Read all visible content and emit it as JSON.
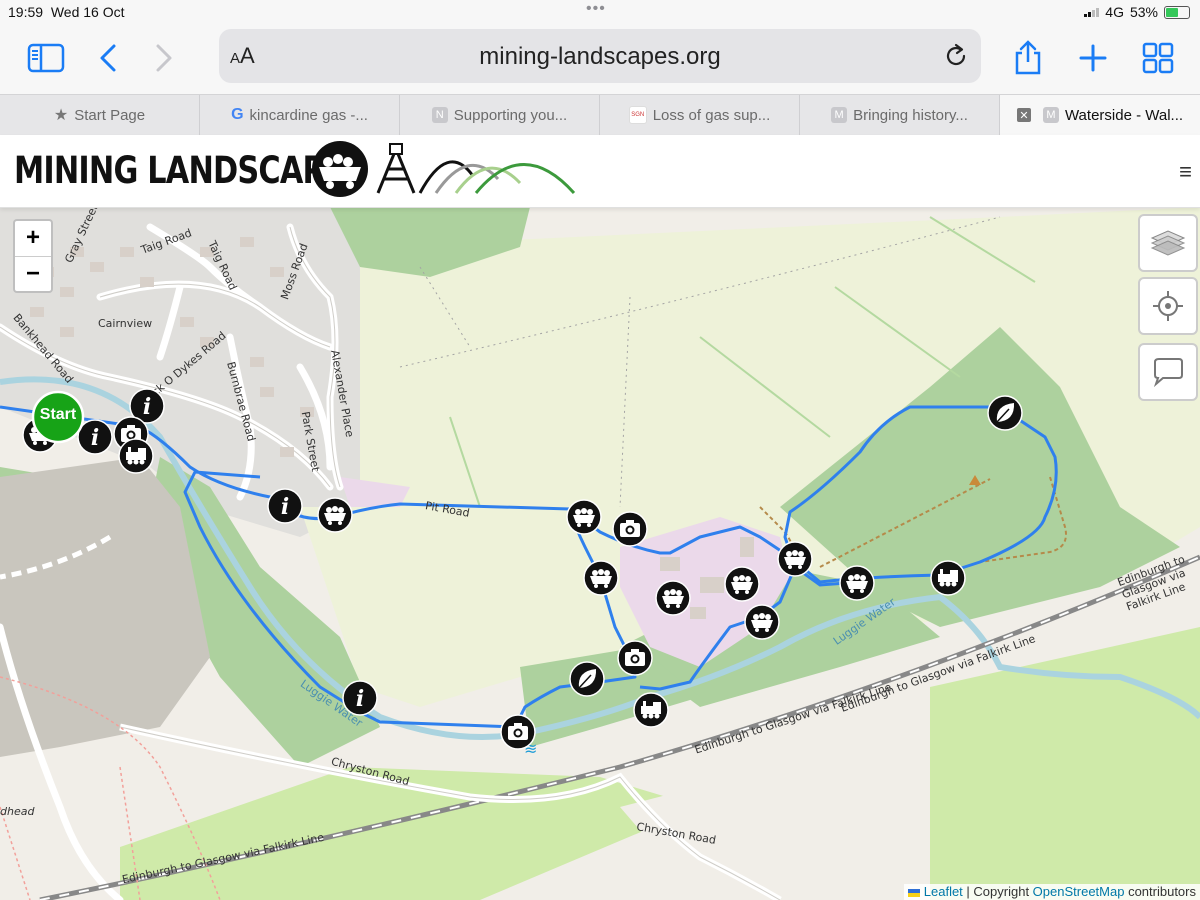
{
  "status_bar": {
    "time": "19:59",
    "date": "Wed 16 Oct",
    "network": "4G",
    "battery": "53%"
  },
  "browser": {
    "url": "mining-landscapes.org",
    "text_size_label": "AA",
    "icons": [
      "sidebar-icon",
      "back-icon",
      "forward-icon",
      "reload-icon",
      "share-icon",
      "new-tab-icon",
      "tab-overview-icon"
    ]
  },
  "tabs": [
    {
      "label": "Start Page",
      "favicon": "star-icon"
    },
    {
      "label": "kincardine gas -...",
      "favicon": "google-icon"
    },
    {
      "label": "Supporting you...",
      "favicon": "N"
    },
    {
      "label": "Loss of gas sup...",
      "favicon": "SGN"
    },
    {
      "label": "Bringing history...",
      "favicon": "M"
    },
    {
      "label": "Waterside - Wal...",
      "favicon": "M",
      "active": true
    }
  ],
  "site": {
    "title": "MINING LANDSCAPES",
    "menu_icon": "hamburger-icon"
  },
  "map": {
    "zoom_in": "+",
    "zoom_out": "−",
    "controls": [
      "layers-icon",
      "locate-icon",
      "comment-icon"
    ],
    "start_label": "Start",
    "street_labels": [
      "Gray Street",
      "Taig Road",
      "Taig Road",
      "Moss Road",
      "Cairnview",
      "Bankhead Road",
      "Back O Dykes Road",
      "Burnbrae Road",
      "Alexander Place",
      "Park Street",
      "Pit Road",
      "Luggie Water",
      "Luggie Water",
      "Chryston Road",
      "Chryston Road",
      "Edinburgh to Glasgow via Falkirk Line",
      "Edinburgh to Glasgow via Falkirk Line",
      "Edinburgh to Glasgow via Falkirk Line",
      "Edinburgh to Glasgow via Falkirk Line",
      "dhead"
    ],
    "attribution": {
      "leaflet": "Leaflet",
      "separator": " | Copyright ",
      "osm": "OpenStreetMap",
      "suffix": " contributors"
    }
  }
}
